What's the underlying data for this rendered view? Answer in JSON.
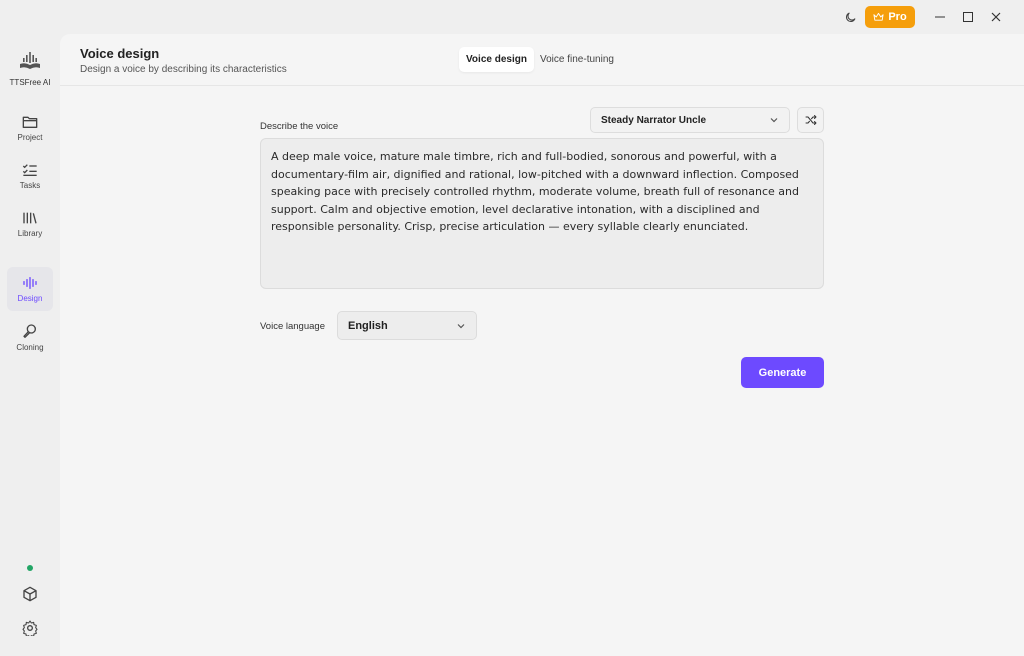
{
  "titlebar": {
    "pro_label": "Pro"
  },
  "sidebar": {
    "app_name": "TTSFree AI",
    "items": [
      {
        "label": "Project",
        "icon": "folder-icon"
      },
      {
        "label": "Tasks",
        "icon": "checklist-icon"
      },
      {
        "label": "Library",
        "icon": "library-icon"
      },
      {
        "label": "Design",
        "icon": "waveform-icon",
        "active": true
      },
      {
        "label": "Cloning",
        "icon": "clone-icon"
      }
    ],
    "status_color": "#22a565"
  },
  "header": {
    "title": "Voice design",
    "subtitle": "Design a voice by describing its characteristics",
    "tabs": [
      {
        "label": "Voice design",
        "active": true
      },
      {
        "label": "Voice fine-tuning",
        "active": false
      }
    ]
  },
  "form": {
    "describe_label": "Describe the voice",
    "preset_selected": "Steady Narrator Uncle",
    "description": "A deep male voice, mature male timbre, rich and full-bodied, sonorous and powerful, with a documentary-film air, dignified and rational, low-pitched with a downward inflection. Composed speaking pace with precisely controlled rhythm, moderate volume, breath full of resonance and support. Calm and objective emotion, level declarative intonation, with a disciplined and responsible personality. Crisp, precise articulation — every syllable clearly enunciated.",
    "language_label": "Voice language",
    "language_selected": "English",
    "generate_label": "Generate"
  },
  "colors": {
    "accent": "#6d4aff",
    "pro": "#f59e0b"
  }
}
